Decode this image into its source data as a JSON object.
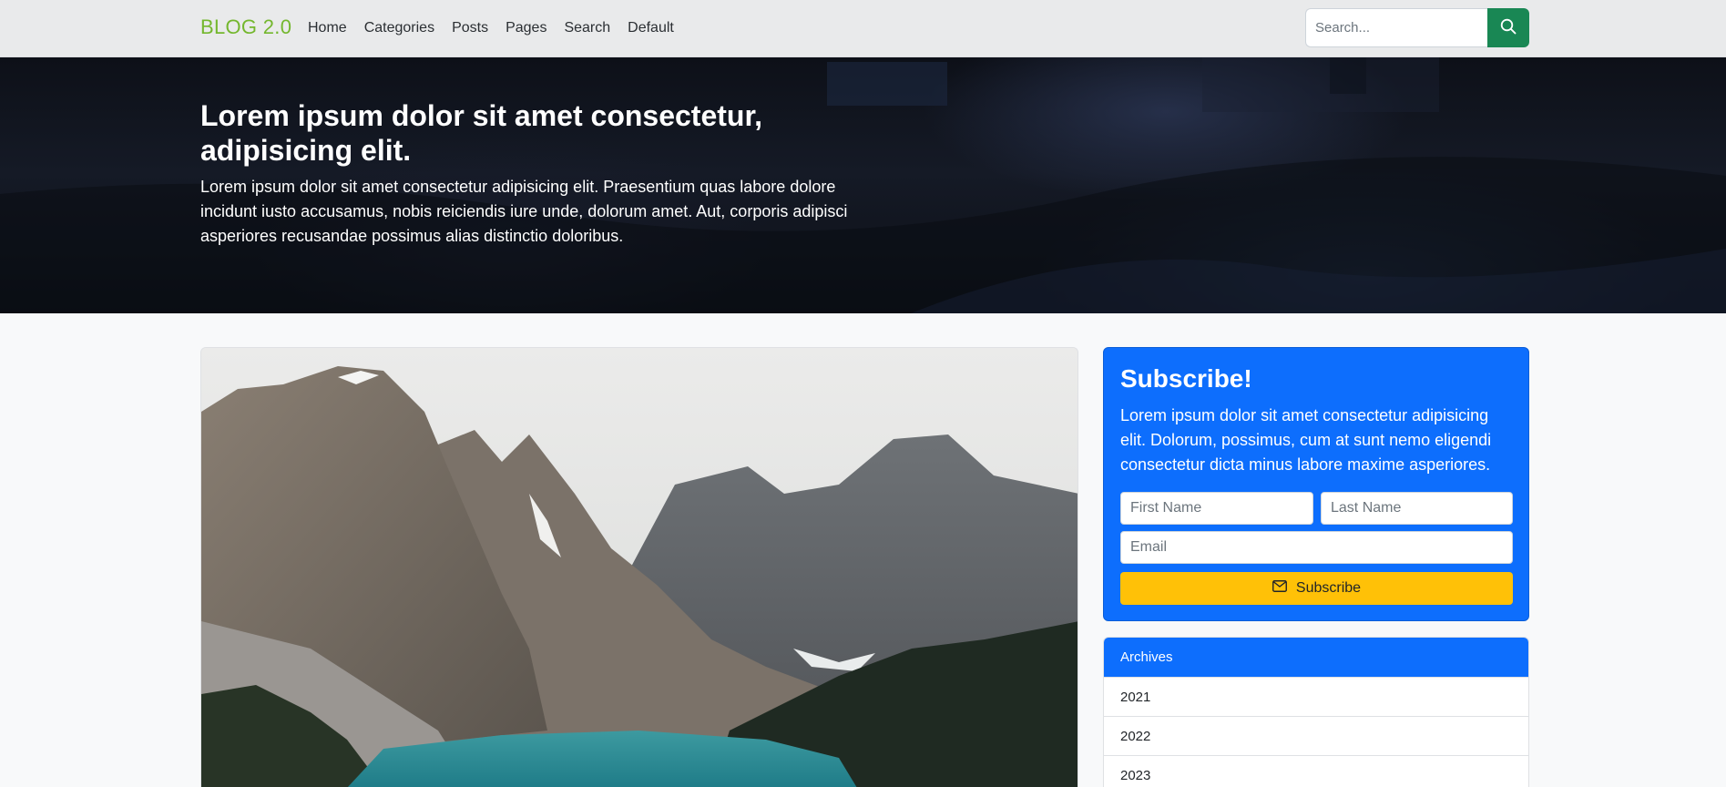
{
  "navbar": {
    "brand": "BLOG 2.0",
    "links": [
      "Home",
      "Categories",
      "Posts",
      "Pages",
      "Search",
      "Default"
    ],
    "search_placeholder": "Search...",
    "search_icon": "search-icon"
  },
  "hero": {
    "title": "Lorem ipsum dolor sit amet consectetur, adipisicing elit.",
    "text": "Lorem ipsum dolor sit amet consectetur adipisicing elit. Praesentium quas labore dolore incidunt iusto accusamus, nobis reiciendis iure unde, dolorum amet. Aut, corporis adipisci asperiores recusandae possimus alias distinctio doloribus."
  },
  "subscribe": {
    "title": "Subscribe!",
    "text": "Lorem ipsum dolor sit amet consectetur adipisicing elit. Dolorum, possimus, cum at sunt nemo eligendi consectetur dicta minus labore maxime asperiores.",
    "first_name_placeholder": "First Name",
    "last_name_placeholder": "Last Name",
    "email_placeholder": "Email",
    "button_label": "Subscribe",
    "button_icon": "envelope-icon"
  },
  "archives": {
    "header": "Archives",
    "items": [
      "2021",
      "2022",
      "2023"
    ]
  },
  "colors": {
    "brand": "#74b72e",
    "primary": "#0d6efd",
    "success": "#198754",
    "warning": "#ffc107"
  }
}
